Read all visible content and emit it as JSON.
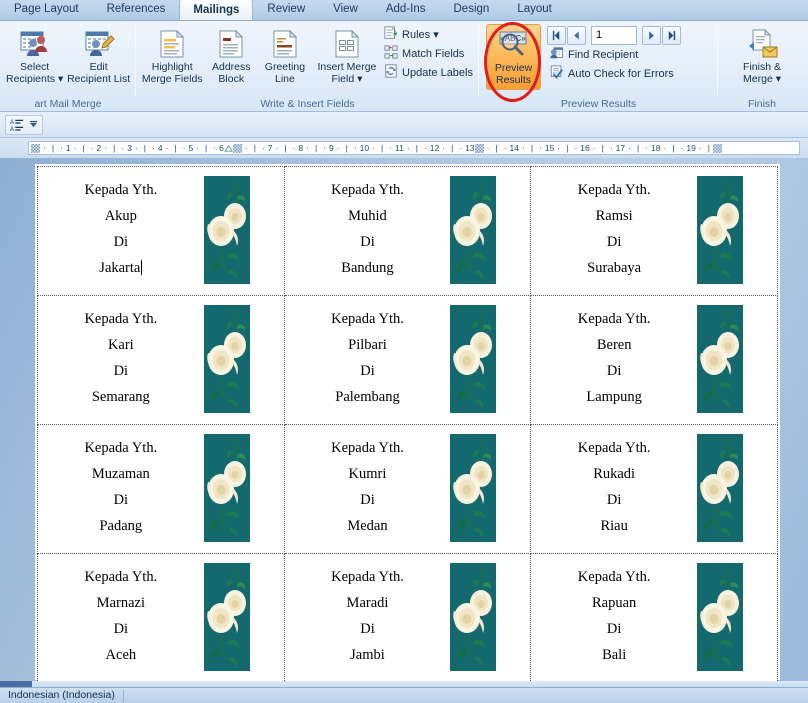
{
  "ribbon": {
    "tabs": [
      {
        "label": "Page Layout",
        "active": false
      },
      {
        "label": "References",
        "active": false
      },
      {
        "label": "Mailings",
        "active": true
      },
      {
        "label": "Review",
        "active": false
      },
      {
        "label": "View",
        "active": false
      },
      {
        "label": "Add-Ins",
        "active": false
      },
      {
        "label": "Design",
        "active": false
      },
      {
        "label": "Layout",
        "active": false
      }
    ],
    "groups": {
      "start_mail_merge": {
        "label": "art Mail Merge",
        "buttons": [
          {
            "id": "select-recipients",
            "line1": "Select",
            "line2": "Recipients ▾",
            "icon": "select-recipients-icon"
          },
          {
            "id": "edit-recipient-list",
            "line1": "Edit",
            "line2": "Recipient List",
            "icon": "edit-recipient-list-icon"
          }
        ]
      },
      "write_insert": {
        "label": "Write & Insert Fields",
        "buttons": [
          {
            "id": "highlight-merge-fields",
            "line1": "Highlight",
            "line2": "Merge Fields",
            "icon": "highlight-merge-fields-icon"
          },
          {
            "id": "address-block",
            "line1": "Address",
            "line2": "Block",
            "icon": "address-block-icon"
          },
          {
            "id": "greeting-line",
            "line1": "Greeting",
            "line2": "Line",
            "icon": "greeting-line-icon"
          },
          {
            "id": "insert-merge-field",
            "line1": "Insert Merge",
            "line2": "Field ▾",
            "icon": "insert-merge-field-icon"
          }
        ],
        "small_buttons": [
          {
            "id": "rules",
            "label": "Rules ▾",
            "icon": "rules-icon"
          },
          {
            "id": "match-fields",
            "label": "Match Fields",
            "icon": "match-fields-icon"
          },
          {
            "id": "update-labels",
            "label": "Update Labels",
            "icon": "update-labels-icon"
          }
        ]
      },
      "preview_results": {
        "label": "Preview Results",
        "main_button": {
          "id": "preview-results",
          "line1": "Preview",
          "line2": "Results",
          "icon": "preview-results-icon",
          "highlighted": true,
          "annotated": true
        },
        "navigation": {
          "first_label": "⏮",
          "prev_label": "◀",
          "record_value": "1",
          "next_label": "▶",
          "last_label": "⏭"
        },
        "small_buttons": [
          {
            "id": "find-recipient",
            "label": "Find Recipient",
            "icon": "find-recipient-icon"
          },
          {
            "id": "auto-check-errors",
            "label": "Auto Check for Errors",
            "icon": "auto-check-errors-icon"
          }
        ]
      },
      "finish": {
        "label": "Finish",
        "main_button": {
          "id": "finish-merge",
          "line1": "Finish &",
          "line2": "Merge ▾",
          "icon": "finish-merge-icon"
        }
      }
    }
  },
  "ruler": {
    "ticks": [
      "1",
      "2",
      "3",
      "4",
      "5",
      "6",
      "7",
      "8",
      "9",
      "10",
      "11",
      "12",
      "13",
      "14",
      "15",
      "16",
      "17",
      "18",
      "19"
    ]
  },
  "document": {
    "label_heading": "Kepada Yth.",
    "label_di": "Di",
    "rows": [
      [
        {
          "name": "Akup",
          "city": "Jakarta",
          "has_caret": true
        },
        {
          "name": "Muhid",
          "city": "Bandung",
          "has_caret": false
        },
        {
          "name": "Ramsi",
          "city": "Surabaya",
          "has_caret": false
        }
      ],
      [
        {
          "name": "Kari",
          "city": "Semarang",
          "has_caret": false
        },
        {
          "name": "Pilbari",
          "city": "Palembang",
          "has_caret": false
        },
        {
          "name": "Beren",
          "city": "Lampung",
          "has_caret": false
        }
      ],
      [
        {
          "name": "Muzaman",
          "city": "Padang",
          "has_caret": false
        },
        {
          "name": "Kumri",
          "city": "Medan",
          "has_caret": false
        },
        {
          "name": "Rukadi",
          "city": "Riau",
          "has_caret": false
        }
      ],
      [
        {
          "name": "Marnazi",
          "city": "Aceh",
          "has_caret": false
        },
        {
          "name": "Maradi",
          "city": "Jambi",
          "has_caret": false
        },
        {
          "name": "Rapuan",
          "city": "Bali",
          "has_caret": false
        }
      ]
    ]
  },
  "statusbar": {
    "language": "Indonesian (Indonesia)"
  },
  "colors": {
    "ribbon_accent": "#bcd3ea",
    "highlight_orange": "#f79e35",
    "annotation_red": "#e21b1b",
    "rose_bg": "#14696e",
    "rose_petal": "#f5ecd2",
    "rose_leaf": "#1d7a4e",
    "page_bg": "#b0c8e2"
  }
}
